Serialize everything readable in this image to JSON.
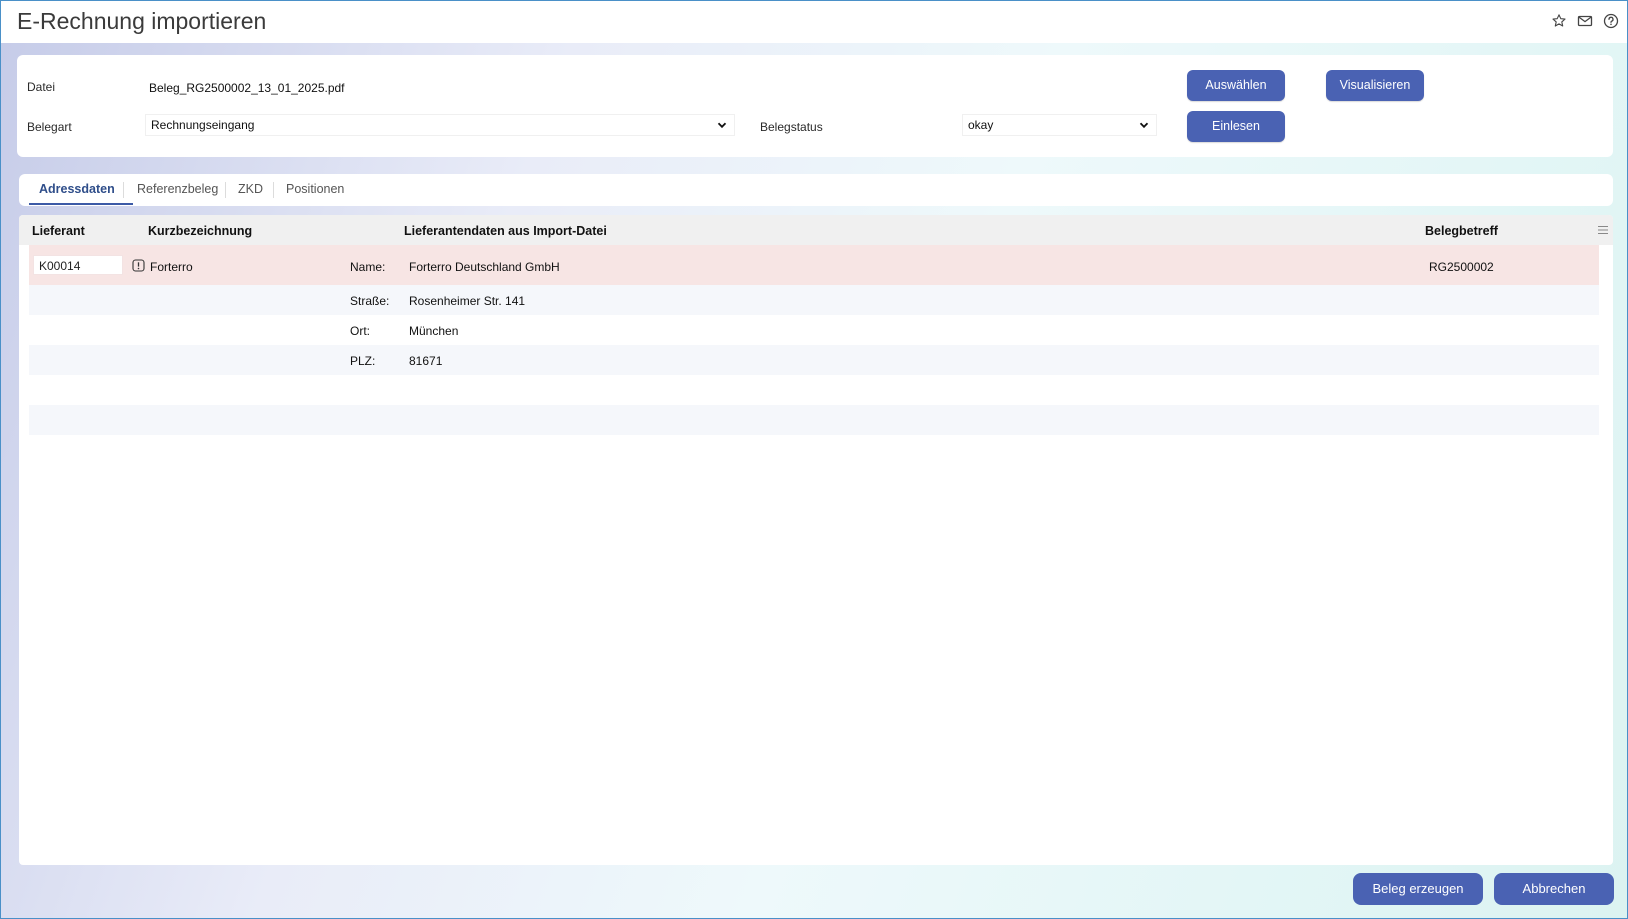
{
  "window": {
    "title": "E-Rechnung importieren"
  },
  "toolbar_icons": [
    "star-icon",
    "mail-icon",
    "help-icon"
  ],
  "form": {
    "datei_label": "Datei",
    "datei_value": "Beleg_RG2500002_13_01_2025.pdf",
    "belegart_label": "Belegart",
    "belegart_value": "Rechnungseingang",
    "belegstatus_label": "Belegstatus",
    "belegstatus_value": "okay",
    "auswaehlen_label": "Auswählen",
    "visualisieren_label": "Visualisieren",
    "einlesen_label": "Einlesen"
  },
  "tabs": [
    {
      "label": "Adressdaten",
      "active": true
    },
    {
      "label": "Referenzbeleg",
      "active": false
    },
    {
      "label": "ZKD",
      "active": false
    },
    {
      "label": "Positionen",
      "active": false
    }
  ],
  "table": {
    "headers": {
      "lieferant": "Lieferant",
      "kurzbezeichnung": "Kurzbezeichnung",
      "lieferantendaten": "Lieferantendaten aus Import-Datei",
      "belegbetreff": "Belegbetreff"
    },
    "row": {
      "lieferant": "K00014",
      "kurzbezeichnung": "Forterro",
      "belegbetreff": "RG2500002",
      "details": [
        {
          "label": "Name:",
          "value": "Forterro Deutschland GmbH"
        },
        {
          "label": "Straße:",
          "value": "Rosenheimer Str. 141"
        },
        {
          "label": "Ort:",
          "value": "München"
        },
        {
          "label": "PLZ:",
          "value": "81671"
        }
      ]
    }
  },
  "footer": {
    "beleg_erzeugen_label": "Beleg erzeugen",
    "abbrechen_label": "Abbrechen"
  },
  "colors": {
    "accent": "#4a62b3",
    "highlight_row": "#f7e5e4",
    "stripe_row": "#f5f7fb"
  }
}
